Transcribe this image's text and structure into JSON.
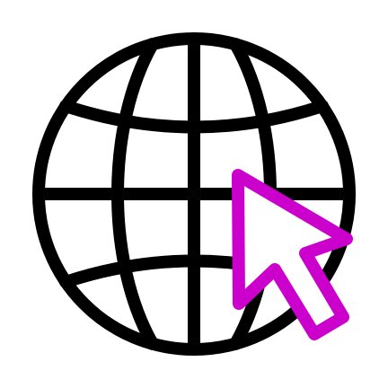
{
  "icon": {
    "name": "web-globe-click",
    "globe_icon": "globe-icon",
    "cursor_icon": "cursor-arrow-icon"
  },
  "colors": {
    "background": "#ffffff",
    "globe_stroke": "#000000",
    "cursor_stroke": "#cc00cc",
    "cursor_fill": "#ffffff"
  }
}
